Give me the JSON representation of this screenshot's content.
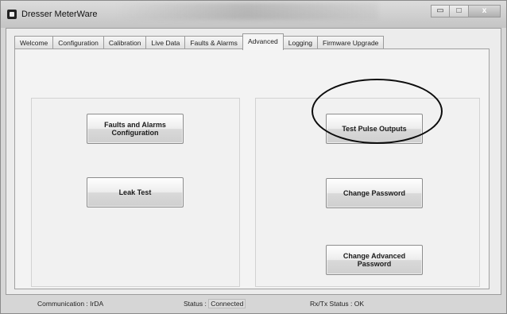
{
  "window": {
    "title": "Dresser MeterWare",
    "controls": {
      "minimize": "▭",
      "maximize": "□",
      "close": "x"
    }
  },
  "tabs": [
    {
      "label": "Welcome",
      "active": false
    },
    {
      "label": "Configuration",
      "active": false
    },
    {
      "label": "Calibration",
      "active": false
    },
    {
      "label": "Live Data",
      "active": false
    },
    {
      "label": "Faults & Alarms",
      "active": false
    },
    {
      "label": "Advanced",
      "active": true
    },
    {
      "label": "Logging",
      "active": false
    },
    {
      "label": "Firmware Upgrade",
      "active": false
    }
  ],
  "advanced": {
    "left": {
      "faults_button": "Faults and Alarms\nConfiguration",
      "leak_button": "Leak Test"
    },
    "right": {
      "pulse_button": "Test Pulse Outputs",
      "password_button": "Change Password",
      "adv_password_button": "Change Advanced\nPassword"
    }
  },
  "status": {
    "communication_label": "Communication :",
    "communication_value": "IrDA",
    "status_label": "Status :",
    "status_value": "Connected",
    "rxtx_label": "Rx/Tx Status :",
    "rxtx_value": "OK"
  }
}
